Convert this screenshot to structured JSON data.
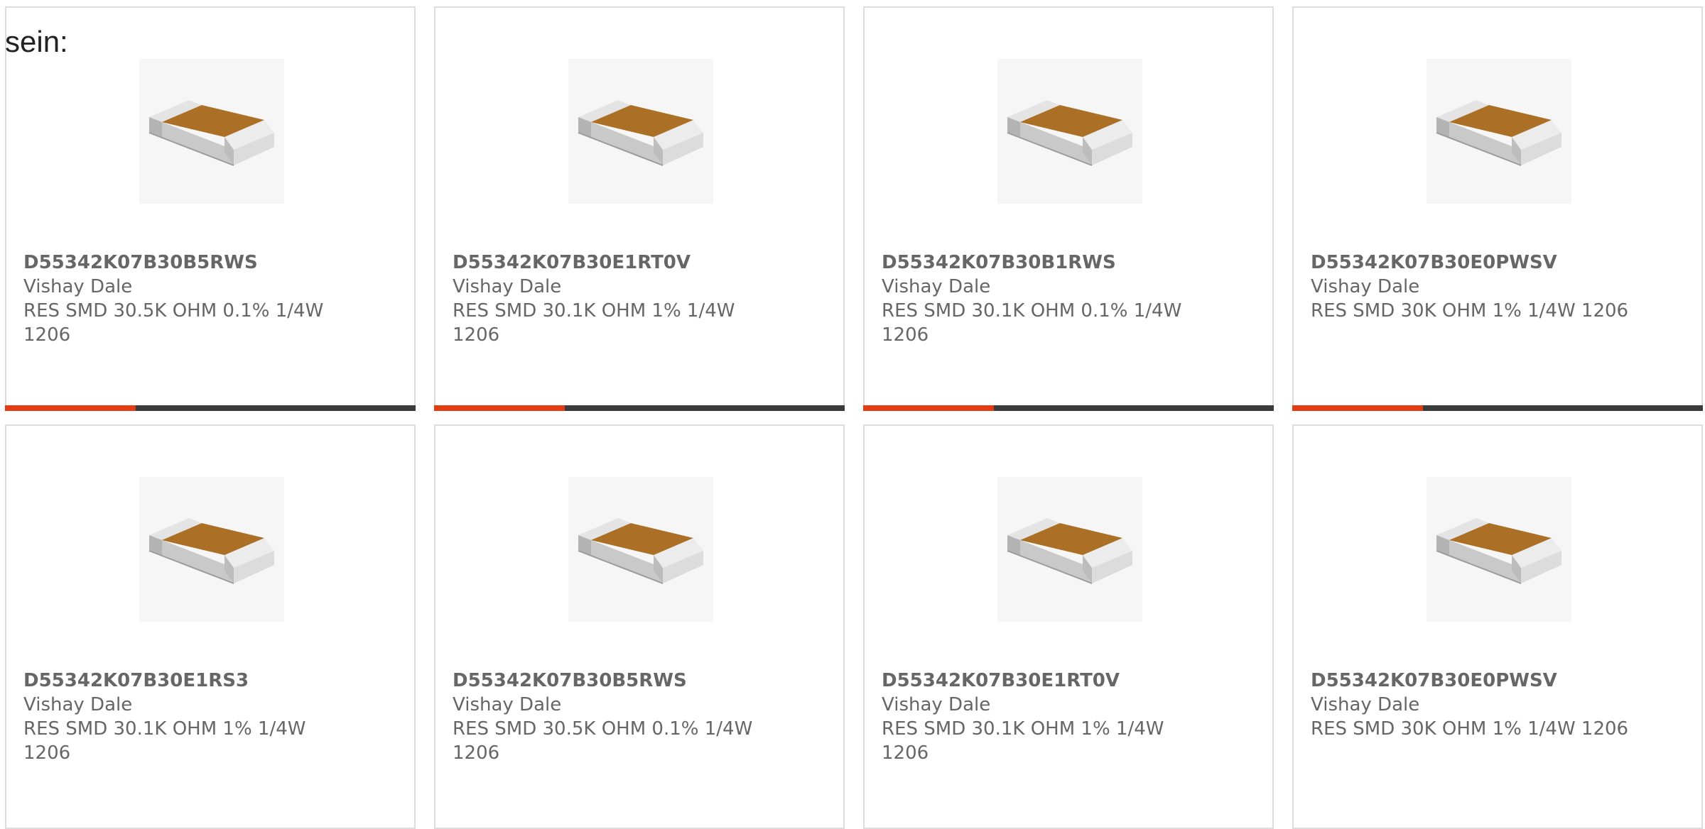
{
  "intro_text": "sein:",
  "colors": {
    "accent": "#e33b12",
    "bar_dark": "#3b3b3b",
    "card_border": "#dddddd",
    "text": "#666666"
  },
  "products": [
    {
      "part_number": "D55342K07B30B5RWS",
      "manufacturer": "Vishay Dale",
      "description": "RES SMD 30.5K OHM 0.1% 1/4W 1206",
      "image_icon": "smd-resistor-image",
      "has_bar": true
    },
    {
      "part_number": "D55342K07B30E1RT0V",
      "manufacturer": "Vishay Dale",
      "description": "RES SMD 30.1K OHM 1% 1/4W 1206",
      "image_icon": "smd-resistor-image",
      "has_bar": true
    },
    {
      "part_number": "D55342K07B30B1RWS",
      "manufacturer": "Vishay Dale",
      "description": "RES SMD 30.1K OHM 0.1% 1/4W 1206",
      "image_icon": "smd-resistor-image",
      "has_bar": true
    },
    {
      "part_number": "D55342K07B30E0PWSV",
      "manufacturer": "Vishay Dale",
      "description": "RES SMD 30K OHM 1% 1/4W 1206",
      "image_icon": "smd-resistor-image",
      "has_bar": true
    },
    {
      "part_number": "D55342K07B30E1RS3",
      "manufacturer": "Vishay Dale",
      "description": "RES SMD 30.1K OHM 1% 1/4W 1206",
      "image_icon": "smd-resistor-image",
      "has_bar": false
    },
    {
      "part_number": "D55342K07B30B5RWS",
      "manufacturer": "Vishay Dale",
      "description": "RES SMD 30.5K OHM 0.1% 1/4W 1206",
      "image_icon": "smd-resistor-image",
      "has_bar": false
    },
    {
      "part_number": "D55342K07B30E1RT0V",
      "manufacturer": "Vishay Dale",
      "description": "RES SMD 30.1K OHM 1% 1/4W 1206",
      "image_icon": "smd-resistor-image",
      "has_bar": false
    },
    {
      "part_number": "D55342K07B30E0PWSV",
      "manufacturer": "Vishay Dale",
      "description": "RES SMD 30K OHM 1% 1/4W 1206",
      "image_icon": "smd-resistor-image",
      "has_bar": false
    }
  ]
}
